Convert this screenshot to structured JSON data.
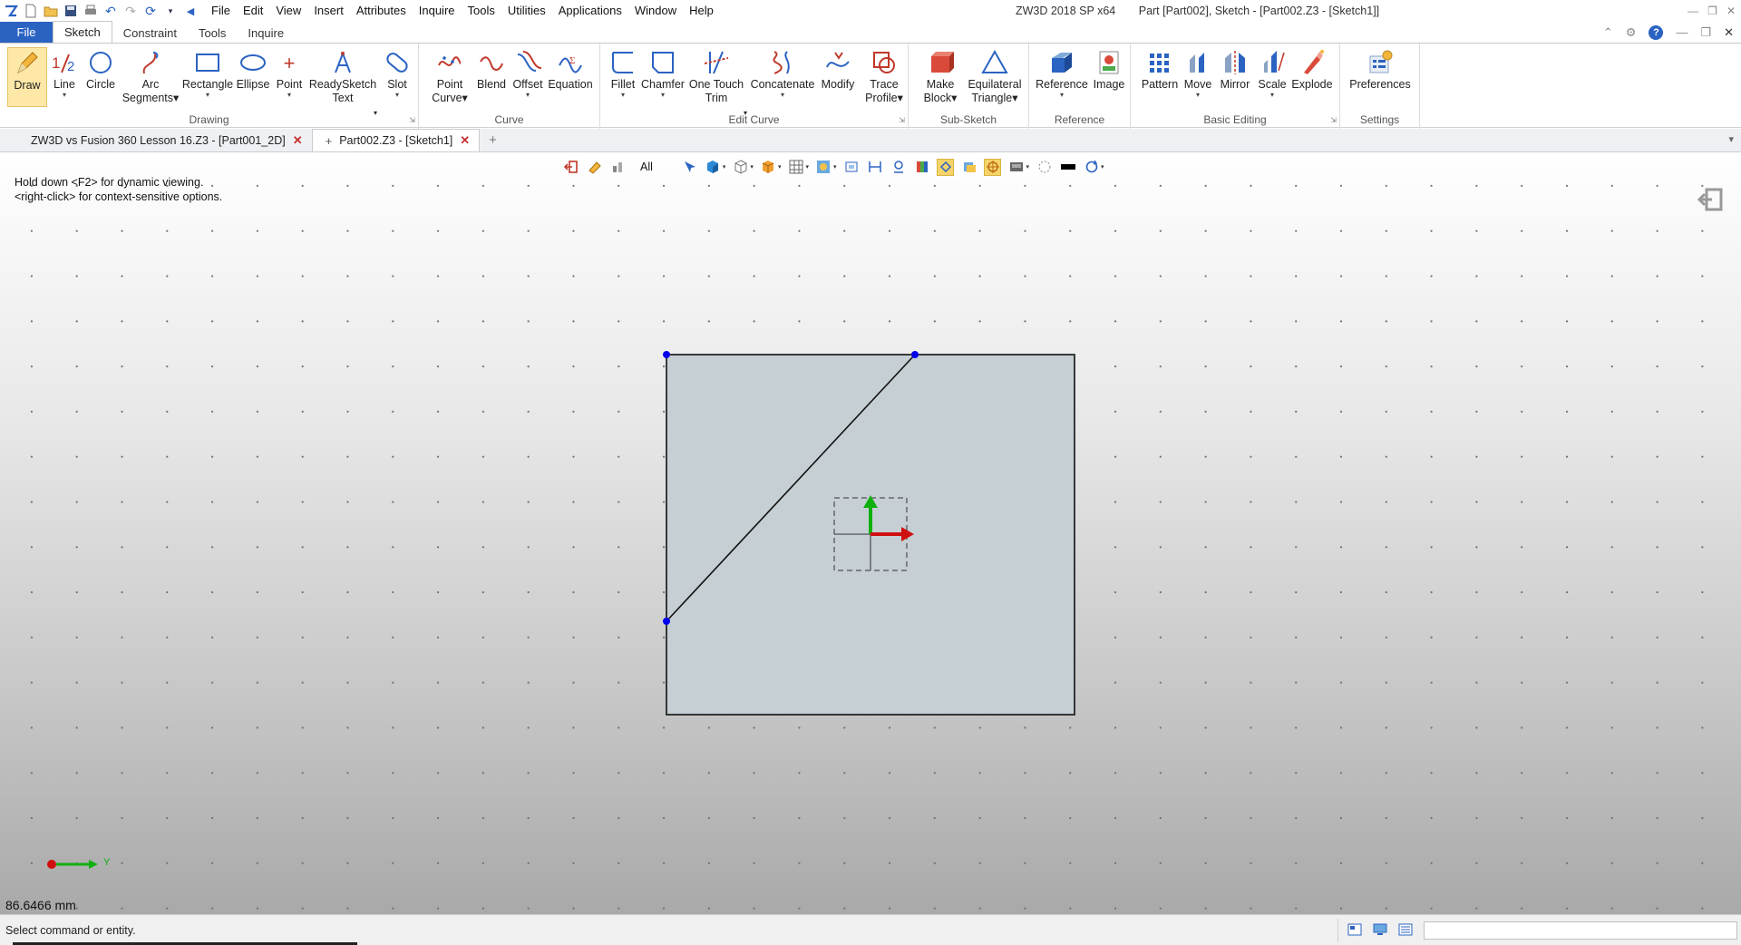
{
  "titlebar": {
    "menu": [
      "File",
      "Edit",
      "View",
      "Insert",
      "Attributes",
      "Inquire",
      "Tools",
      "Utilities",
      "Applications",
      "Window",
      "Help"
    ],
    "app_version": "ZW3D 2018 SP x64",
    "document_title": "Part [Part002],  Sketch - [Part002.Z3 - [Sketch1]]"
  },
  "ribbon_tabs": {
    "file": "File",
    "tabs": [
      "Sketch",
      "Constraint",
      "Tools",
      "Inquire"
    ],
    "active": "Sketch"
  },
  "ribbon": {
    "groups": {
      "drawing": "Drawing",
      "curve": "Curve",
      "edit_curve": "Edit Curve",
      "sub_sketch": "Sub-Sketch",
      "reference": "Reference",
      "basic_editing": "Basic Editing",
      "settings": "Settings"
    },
    "buttons": {
      "draw": "Draw",
      "line": "Line",
      "circle": "Circle",
      "arc_segments": [
        "Arc",
        "Segments"
      ],
      "rectangle": "Rectangle",
      "ellipse": "Ellipse",
      "point": "Point",
      "readysketch_text": [
        "ReadySketch",
        "Text"
      ],
      "slot": "Slot",
      "point_curve": [
        "Point",
        "Curve"
      ],
      "blend": "Blend",
      "offset": "Offset",
      "equation": "Equation",
      "fillet": "Fillet",
      "chamfer": "Chamfer",
      "one_touch_trim": [
        "One Touch",
        "Trim"
      ],
      "concatenate": "Concatenate",
      "modify": "Modify",
      "trace_profile": [
        "Trace",
        "Profile"
      ],
      "make_block": [
        "Make",
        "Block"
      ],
      "equilateral_triangle": [
        "Equilateral",
        "Triangle"
      ],
      "reference": "Reference",
      "image": "Image",
      "pattern": "Pattern",
      "move": "Move",
      "mirror": "Mirror",
      "scale": "Scale",
      "explode": "Explode",
      "preferences": "Preferences"
    }
  },
  "doc_tabs": [
    {
      "label": "ZW3D vs Fusion 360 Lesson 16.Z3 - [Part001_2D]",
      "active": false
    },
    {
      "label": "Part002.Z3 - [Sketch1]",
      "active": true
    }
  ],
  "view_toolbar": {
    "filter_label": "All"
  },
  "viewport": {
    "hint_line1": "Hold down <F2> for dynamic viewing.",
    "hint_line2": "<right-click> for context-sensitive options.",
    "distance_readout": "86.6466 mm",
    "axis_label": "Y"
  },
  "statusbar": {
    "message": "Select command or entity."
  },
  "colors": {
    "file_tab": "#2b63c2",
    "sketch_fill": "#c6cfd4",
    "vertex": "#0000ee",
    "x_axis": "#d01010",
    "y_axis": "#10b010",
    "active_tool": "#fde8a8"
  }
}
